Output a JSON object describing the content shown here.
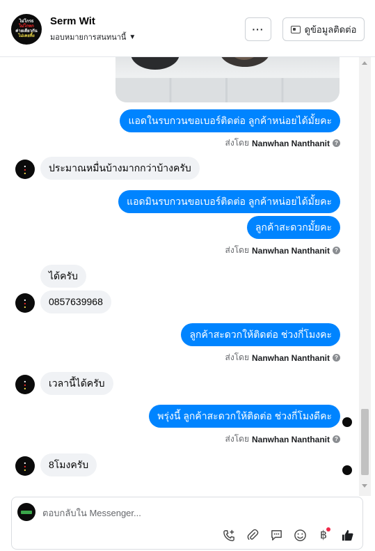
{
  "header": {
    "page_name": "Serm Wit",
    "assign_label": "มอบหมายการสนทนานี้",
    "more_label": "···",
    "contact_label": "ดูข้อมูลติดต่อ",
    "avatar_lines": [
      "ไม่โกรธ",
      "ไม่โกหก",
      "ค่ายเดียวกัน",
      "ไม่เคยทิ้ง"
    ]
  },
  "messages": [
    {
      "side": "out",
      "text": "แอดในรบกวนขอเบอร์ติดต่อ ลูกค้าหน่อยได้มั้ยคะ"
    },
    {
      "side": "sent_by",
      "prefix": "ส่งโดย",
      "name": "Nanwhan Nanthanit"
    },
    {
      "side": "in",
      "text": "ประมาณหมื่นบ้างมากกว่าบ้างครับ"
    },
    {
      "side": "out",
      "text": "แอดมินรบกวนขอเบอร์ติดต่อ ลูกค้าหน่อยได้มั้ยคะ"
    },
    {
      "side": "out",
      "text": "ลูกค้าสะดวกมั้ยคะ"
    },
    {
      "side": "sent_by",
      "prefix": "ส่งโดย",
      "name": "Nanwhan Nanthanit"
    },
    {
      "side": "in",
      "text": "ได้ครับ"
    },
    {
      "side": "in",
      "text": "0857639968"
    },
    {
      "side": "out",
      "text": "ลูกค้าสะดวกให้ติดต่อ ช่วงกี่โมงคะ"
    },
    {
      "side": "sent_by",
      "prefix": "ส่งโดย",
      "name": "Nanwhan Nanthanit"
    },
    {
      "side": "in",
      "text": "เวลานี้ได้ครับ"
    },
    {
      "side": "out",
      "text": "พรุ่งนี้ ลูกค้าสะดวกให้ติดต่อ ช่วงกี่โมงดีคะ"
    },
    {
      "side": "sent_by",
      "prefix": "ส่งโดย",
      "name": "Nanwhan Nanthanit"
    },
    {
      "side": "in",
      "text": "8โมงครับ"
    }
  ],
  "composer": {
    "placeholder": "ตอบกลับใน Messenger...",
    "tools": [
      "phone-plus-icon",
      "paperclip-icon",
      "saved-reply-icon",
      "emoji-icon",
      "baht-payment-icon",
      "thumbs-up-icon"
    ]
  },
  "colors": {
    "outgoing_bubble": "#0084ff",
    "incoming_bubble": "#f0f2f5",
    "notification_dot": "#f02849"
  }
}
